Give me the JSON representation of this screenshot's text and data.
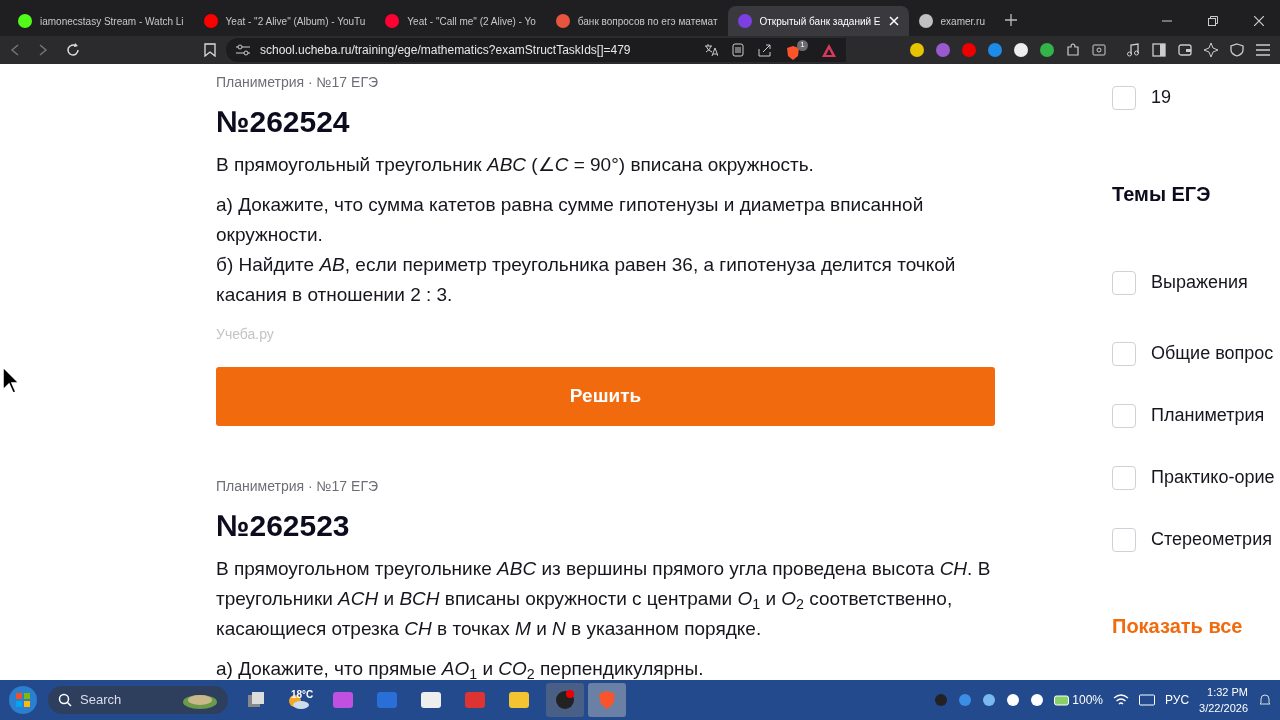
{
  "tabs": [
    {
      "title": "iamonecstasy Stream - Watch Li",
      "selected": false,
      "color": "#53fc18"
    },
    {
      "title": "Yeat - \"2 Alive\" (Album) - YouTu",
      "selected": false,
      "color": "#ff0000"
    },
    {
      "title": "Yeat - \"Call me\" (2 Alive) - Yo",
      "selected": false,
      "color": "#ff0033"
    },
    {
      "title": "банк вопросов по егэ математ",
      "selected": false,
      "color": "#e8553e"
    },
    {
      "title": "Открытый банк заданий Е",
      "selected": true,
      "color": "#7b3fe4"
    },
    {
      "title": "examer.ru",
      "selected": false,
      "color": "#c0c0c0"
    }
  ],
  "address": "school.ucheba.ru/training/ege/mathematics?examStructTaskIds[]=479",
  "brave_badge": "1",
  "tasks": [
    {
      "breadcrumb": "Планиметрия · №17 ЕГЭ",
      "number": "№262524",
      "paragraphs": [
        "В прямоугольный треугольник *ABC* (∠*C* = 90°) вписана окружность.",
        "а) Докажите, что сумма катетов равна сумме гипотенузы и диаметра вписанной окружности.\nб) Найдите *AB*, если периметр треугольника равен 36, а гипотенуза делится точкой касания в отношении 2 : 3."
      ],
      "source": "Учеба.ру",
      "button": "Решить"
    },
    {
      "breadcrumb": "Планиметрия · №17 ЕГЭ",
      "number": "№262523",
      "paragraphs": [
        "В прямоугольном треугольнике *ABC* из вершины прямого угла проведена высота *CH*. В треугольники *ACH* и *BCH* вписаны окружности с центрами *O*$_{1}$ и *O*$_{2}$ соответственно, касающиеся отрезка *CH* в точках *M* и *N* в указанном порядке.",
        "а) Докажите, что прямые *AO*$_{1}$ и *CO*$_{2}$ перпендикулярны."
      ]
    }
  ],
  "sidebar": {
    "top_option": {
      "label": "19",
      "checked": false
    },
    "heading": "Темы ЕГЭ",
    "topics": [
      {
        "label": "Выражения",
        "checked": false
      },
      {
        "label": "Общие вопрос",
        "checked": false
      },
      {
        "label": "Планиметрия",
        "checked": false
      },
      {
        "label": "Практико-орие",
        "checked": false
      },
      {
        "label": "Стереометрия",
        "checked": false
      }
    ],
    "show_all": "Показать все"
  },
  "taskbar": {
    "search": "Search",
    "weather": "18°C",
    "battery": "100%",
    "language": "РУС",
    "time": "1:32 PM",
    "date": "3/22/2026"
  }
}
